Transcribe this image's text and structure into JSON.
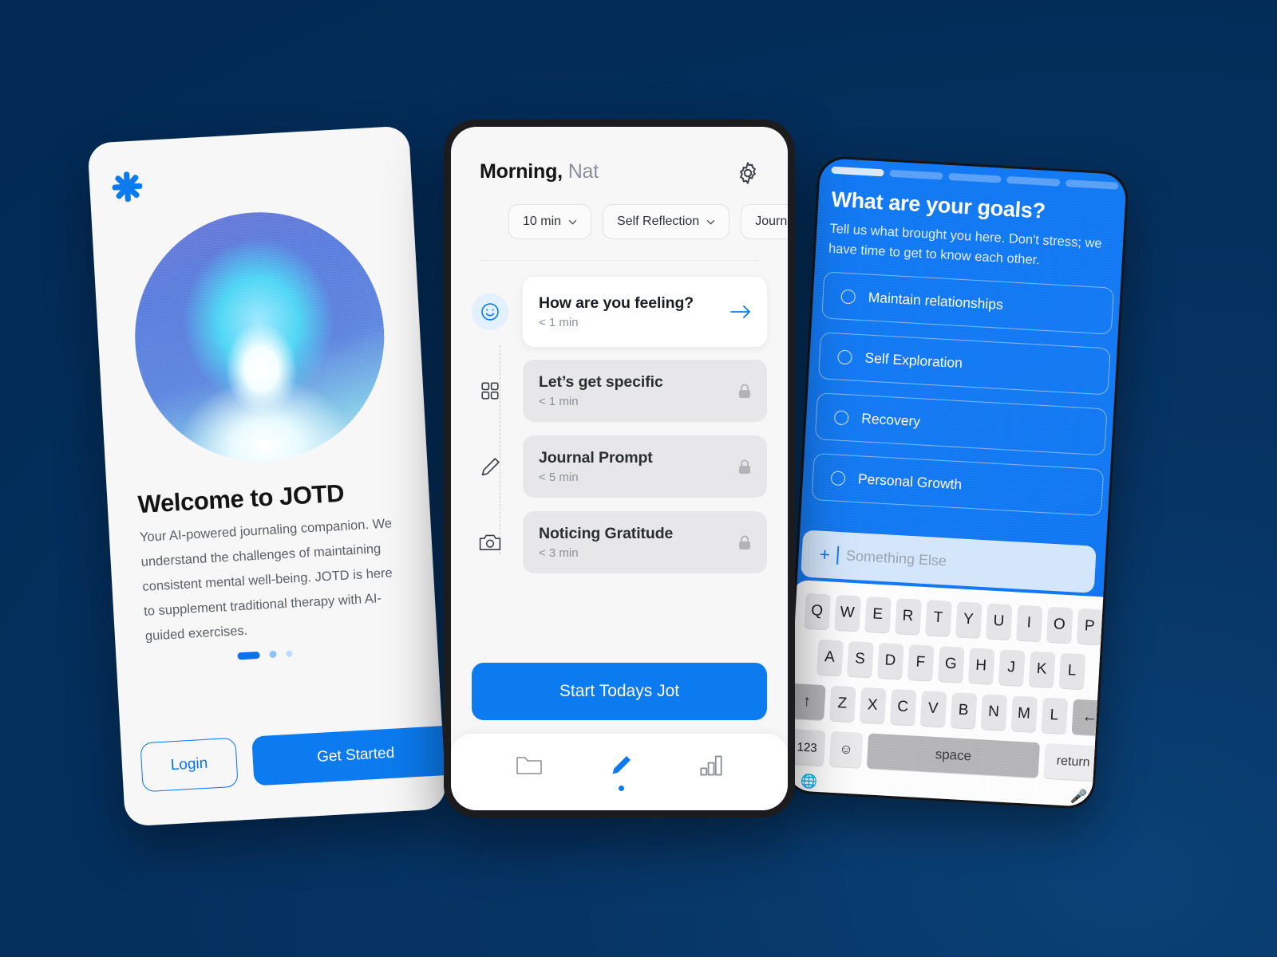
{
  "background": {
    "color": "#052f5f"
  },
  "accent": {
    "blue": "#0b7bef",
    "navy": "#052f5f",
    "muted_gray": "#8b9097"
  },
  "welcome_card": {
    "logo_icon": "asterisk-logo-icon",
    "hero_image_alt": "gradient-orb-illustration",
    "title": "Welcome to JOTD",
    "body": "Your AI-powered journaling companion. We understand the challenges of maintaining consistent mental well-being. JOTD is here to supplement traditional therapy with AI-guided exercises.",
    "pagination": {
      "total": 3,
      "active_index": 0
    },
    "buttons": {
      "secondary": "Login",
      "primary": "Get Started"
    }
  },
  "morning_phone": {
    "greeting_prefix": "Morning,",
    "user_name": "Nat",
    "settings_icon": "gear-icon",
    "filters": [
      {
        "label": "10 min",
        "icon": "chevron-down-icon"
      },
      {
        "label": "Self Reflection",
        "icon": "chevron-down-icon"
      },
      {
        "label": "Journal Prompt",
        "icon": "chevron-down-icon"
      }
    ],
    "tasks": [
      {
        "title": "How are you feeling?",
        "duration": "< 1 min",
        "icon": "smiley-face-icon",
        "state": "active",
        "action_icon": "arrow-right-icon"
      },
      {
        "title": "Let’s get specific",
        "duration": "< 1 min",
        "icon": "grid-squares-icon",
        "state": "locked",
        "action_icon": "lock-icon"
      },
      {
        "title": "Journal Prompt",
        "duration": "< 5 min",
        "icon": "pencil-icon",
        "state": "locked",
        "action_icon": "lock-icon"
      },
      {
        "title": "Noticing Gratitude",
        "duration": "< 3 min",
        "icon": "camera-icon",
        "state": "locked",
        "action_icon": "lock-icon"
      }
    ],
    "cta_label": "Start Todays Jot",
    "tabbar": [
      {
        "icon": "folder-icon",
        "active": false
      },
      {
        "icon": "pencil-icon",
        "active": true
      },
      {
        "icon": "bar-chart-icon",
        "active": false
      }
    ]
  },
  "goals_phone": {
    "progress": {
      "segments": 5,
      "completed": 1
    },
    "title": "What are your goals?",
    "subtitle": "Tell us what brought you here. Don't stress; we have time to get to know each other.",
    "options": [
      {
        "label": "Maintain relationships",
        "selected": false
      },
      {
        "label": "Self Exploration",
        "selected": false
      },
      {
        "label": "Recovery",
        "selected": false
      },
      {
        "label": "Personal Growth",
        "selected": false
      }
    ],
    "custom_input": {
      "plus": "+",
      "placeholder": "Something Else",
      "value": ""
    },
    "keyboard": {
      "row1": [
        "Q",
        "W",
        "E",
        "R",
        "T",
        "Y",
        "U",
        "I",
        "O",
        "P"
      ],
      "row2": [
        "A",
        "S",
        "D",
        "F",
        "G",
        "H",
        "J",
        "K",
        "L"
      ],
      "row3_shift": "↑",
      "row3": [
        "Z",
        "X",
        "C",
        "V",
        "B",
        "N",
        "M",
        "L"
      ],
      "row3_backspace": "←",
      "num_key": "123",
      "emoji_key": "☺",
      "space_key": "space",
      "return_key": "return",
      "globe_icon": "globe-icon",
      "mic_icon": "microphone-icon"
    }
  }
}
